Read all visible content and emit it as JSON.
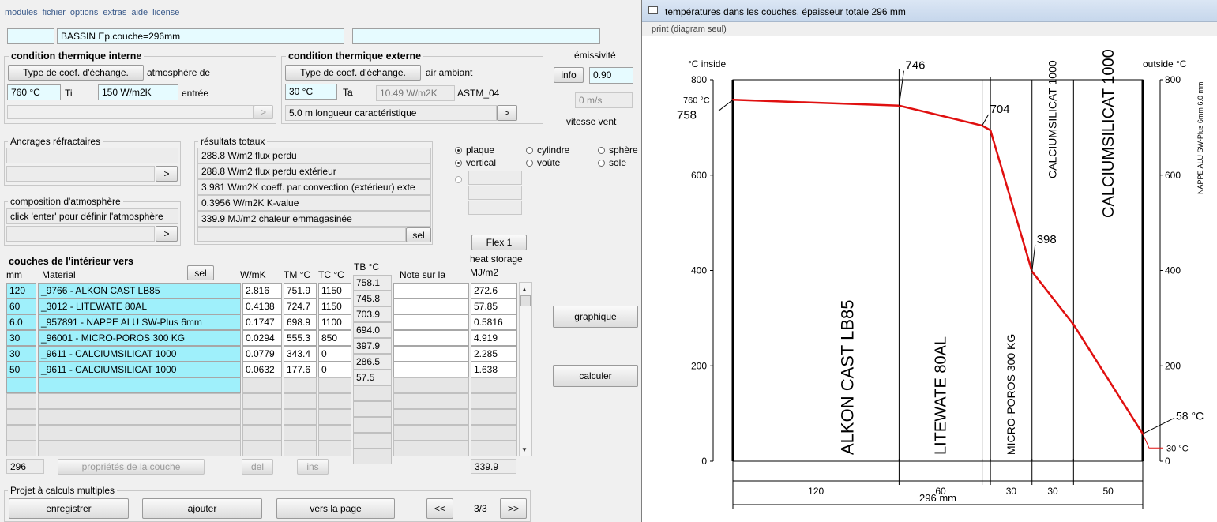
{
  "menu": [
    "modules",
    "fichier",
    "options",
    "extras",
    "aide",
    "license"
  ],
  "header": {
    "code": "",
    "title": "BASSIN Ep.couche=296mm",
    "extra": ""
  },
  "internal": {
    "title": "condition thermique interne",
    "coef_btn": "Type de coef. d'échange.",
    "atmo_label": "atmosphère de",
    "temp": "760 °C",
    "temp_symbol": "Ti",
    "coef": "150 W/m2K",
    "coef_suffix": "entrée",
    "more_btn": ">"
  },
  "external": {
    "title": "condition thermique externe",
    "coef_btn": "Type de coef. d'échange.",
    "air_label": "air ambiant",
    "temp": "30 °C",
    "temp_symbol": "Ta",
    "coef": "10.49 W/m2K",
    "coef_suffix": "ASTM_04",
    "length": "5.0 m  longueur caractéristique",
    "more_btn": ">"
  },
  "emissivity": {
    "label": "émissivité",
    "info_btn": "info",
    "value": "0.90",
    "wind": "0 m/s",
    "wind_label": "vitesse vent"
  },
  "anchors": {
    "title": "Ancrages réfractaires",
    "more_btn": ">"
  },
  "atmosphere": {
    "title": "composition d'atmosphère",
    "hint": "click 'enter' pour définir l'atmosphère",
    "more_btn": ">"
  },
  "results": {
    "title": "résultats totaux",
    "lines": [
      "288.8 W/m2 flux perdu",
      "288.8 W/m2 flux perdu extérieur",
      "3.981 W/m2K coeff. par convection (extérieur) exte",
      "0.3956 W/m2K K-value",
      "339.9 MJ/m2 chaleur emmagasinée"
    ],
    "sel_btn": "sel"
  },
  "geometry": {
    "plaque": "plaque",
    "cylindre": "cylindre",
    "sphere": "sphère",
    "vertical": "vertical",
    "voute": "voûte",
    "sole": "sole"
  },
  "flex_btn": "Flex 1",
  "layers": {
    "title": "couches de l'intérieur vers",
    "headers": {
      "mm": "mm",
      "material": "Material",
      "sel": "sel",
      "wmk": "W/mK",
      "tm": "TM °C",
      "tc": "TC °C",
      "tb": "TB °C",
      "note": "Note sur la",
      "heat1": "heat storage",
      "heat2": "MJ/m2"
    },
    "rows": [
      {
        "mm": "120",
        "material": "_9766 - ALKON CAST LB85",
        "wmk": "2.816",
        "tm": "751.9",
        "tc": "1150",
        "heat": "272.6"
      },
      {
        "mm": "60",
        "material": "_3012 - LITEWATE 80AL",
        "wmk": "0.4138",
        "tm": "724.7",
        "tc": "1150",
        "heat": "57.85"
      },
      {
        "mm": "6.0",
        "material": "_957891 - NAPPE ALU SW-Plus 6mm",
        "wmk": "0.1747",
        "tm": "698.9",
        "tc": "1100",
        "heat": "0.5816"
      },
      {
        "mm": "30",
        "material": "_96001 - MICRO-POROS 300 KG",
        "wmk": "0.0294",
        "tm": "555.3",
        "tc": "850",
        "heat": "4.919"
      },
      {
        "mm": "30",
        "material": "_9611 - CALCIUMSILICAT 1000",
        "wmk": "0.0779",
        "tm": "343.4",
        "tc": "0",
        "heat": "2.285"
      },
      {
        "mm": "50",
        "material": "_9611 - CALCIUMSILICAT 1000",
        "wmk": "0.0632",
        "tm": "177.6",
        "tc": "0",
        "heat": "1.638"
      }
    ],
    "tb": [
      "758.1",
      "745.8",
      "703.9",
      "694.0",
      "397.9",
      "286.5",
      "57.5"
    ],
    "total_mm": "296",
    "total_heat": "339.9",
    "props_btn": "propriétés de la couche",
    "del_btn": "del",
    "ins_btn": "ins"
  },
  "actions": {
    "graph": "graphique",
    "calc": "calculer"
  },
  "project": {
    "title": "Projet à calculs multiples",
    "save": "enregistrer",
    "add": "ajouter",
    "page": "vers la page",
    "prev": "<<",
    "counter": "3/3",
    "next": ">>"
  },
  "chart_window": {
    "title": "températures dans les couches, épaisseur totale 296 mm",
    "print": "print (diagram seul)"
  },
  "chart_data": {
    "type": "line",
    "x": [
      0,
      120,
      180,
      186,
      216,
      246,
      296
    ],
    "y": [
      758.1,
      745.8,
      703.9,
      694.0,
      397.9,
      286.5,
      57.5
    ],
    "xlim": [
      0,
      296
    ],
    "ylim": [
      0,
      800
    ],
    "yticks": [
      "0",
      "200",
      "400",
      "600",
      "800"
    ],
    "yticks_right": [
      "0",
      "200",
      "400",
      "600",
      "800"
    ],
    "label_left": "°C  inside",
    "label_right": "outside  °C",
    "peak_labels": [
      "746",
      "704",
      "398"
    ],
    "start_label": "758",
    "end_label": "58 °C",
    "ti_label": "760 °C",
    "ta_label": "30 °C",
    "layer_names": [
      "ALKON CAST LB85",
      "LITEWATE 80AL",
      "NAPPE ALU SW-Plus 6mm  6.0 mm",
      "MICRO-POROS 300 KG",
      "CALCIUMSILICAT 1000",
      "CALCIUMSILICAT 1000"
    ],
    "thickness_labels": [
      "120",
      "60",
      "30",
      "30",
      "50"
    ],
    "total_label": "296 mm",
    "line_color": "#e01010",
    "grid": false
  }
}
